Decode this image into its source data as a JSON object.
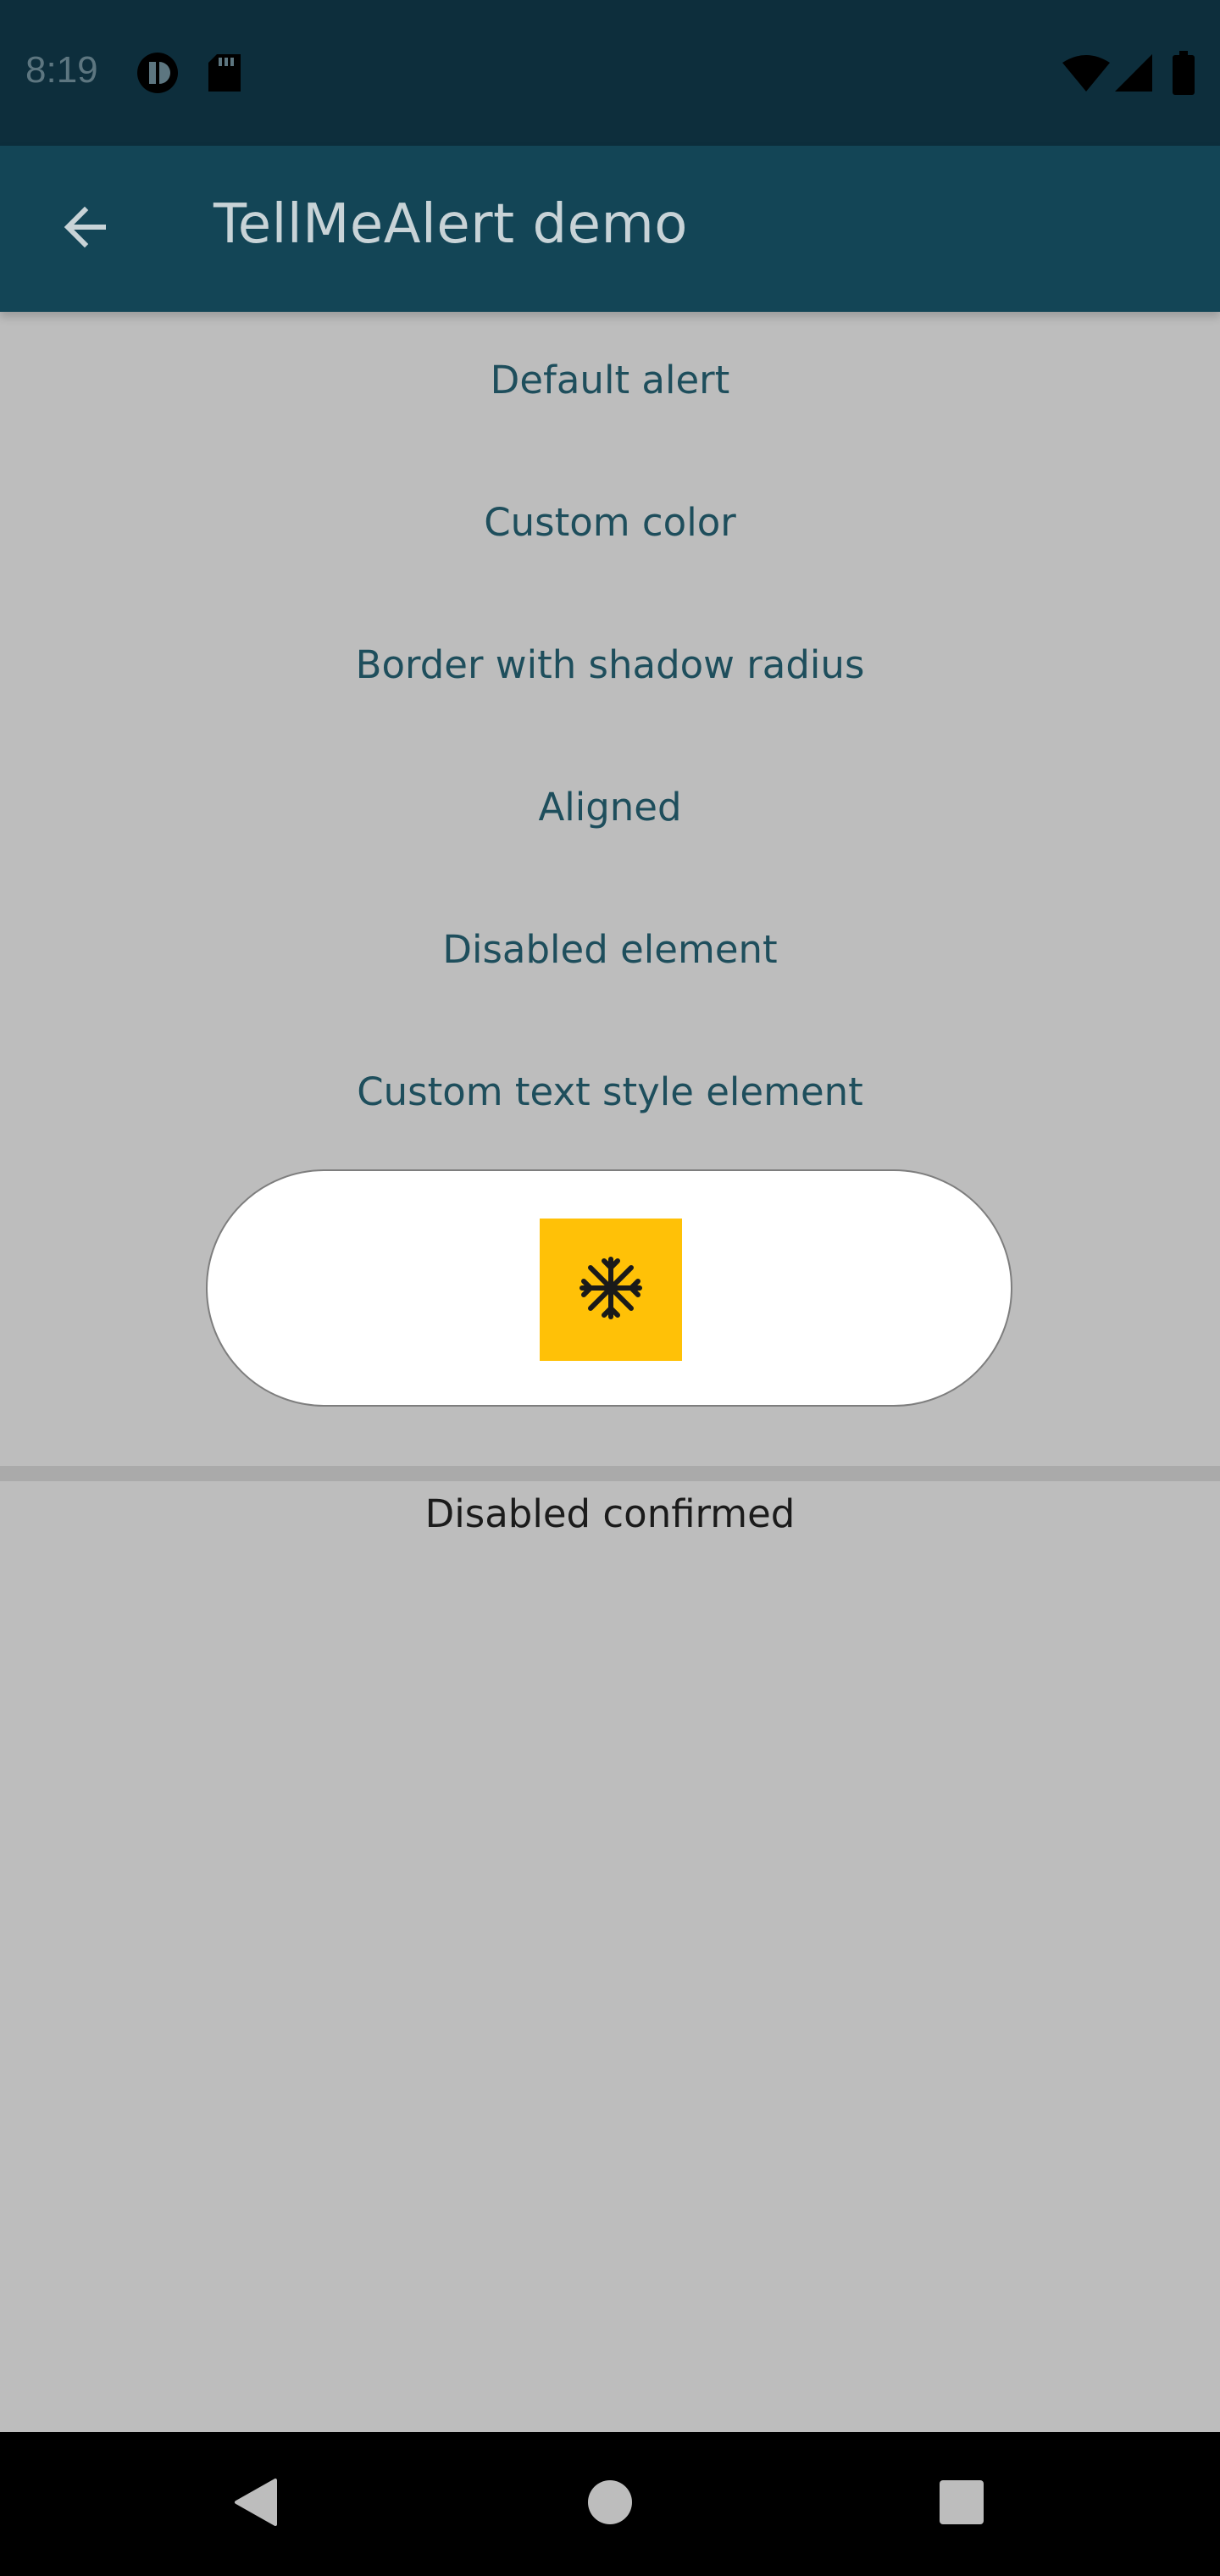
{
  "status_bar": {
    "time": "8:19",
    "icons": [
      "app-notification-icon",
      "sd-card-icon",
      "wifi-icon",
      "cell-signal-icon",
      "battery-icon"
    ]
  },
  "app_bar": {
    "title": "TellMeAlert demo",
    "back_icon": "arrow-back-icon"
  },
  "menu": {
    "items": [
      {
        "label": "Default alert"
      },
      {
        "label": "Custom color"
      },
      {
        "label": "Border with shadow radius"
      },
      {
        "label": "Aligned"
      },
      {
        "label": "Disabled element"
      },
      {
        "label": "Custom text style element"
      }
    ]
  },
  "alert": {
    "icon": "snowflake-icon",
    "icon_background": "#ffc107"
  },
  "result": {
    "text": "Disabled confirmed"
  },
  "nav_bar": {
    "icons": [
      "back-triangle-icon",
      "home-circle-icon",
      "recents-square-icon"
    ]
  },
  "colors": {
    "status_bar": "#0d2e3c",
    "app_bar": "#134556",
    "background": "#bdbdbd",
    "menu_text": "#1e4e5c"
  }
}
